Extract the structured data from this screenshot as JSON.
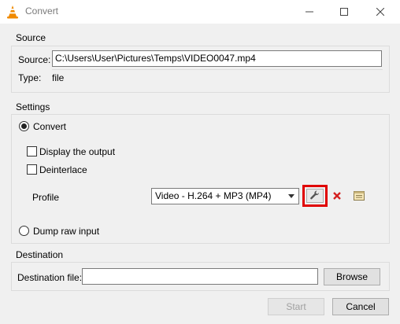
{
  "window": {
    "title": "Convert"
  },
  "source": {
    "group_title": "Source",
    "source_label": "Source:",
    "source_value": "C:\\Users\\User\\Pictures\\Temps\\VIDEO0047.mp4",
    "type_label": "Type:",
    "type_value": "file"
  },
  "settings": {
    "group_title": "Settings",
    "convert_label": "Convert",
    "display_output_label": "Display the output",
    "deinterlace_label": "Deinterlace",
    "profile_label": "Profile",
    "profile_selected": "Video - H.264 + MP3 (MP4)",
    "dump_raw_label": "Dump raw input",
    "icons": [
      "wrench-icon",
      "delete-x-icon",
      "new-profile-icon"
    ],
    "highlight_color": "#e00000"
  },
  "destination": {
    "group_title": "Destination",
    "file_label": "Destination file:",
    "file_value": "",
    "browse_label": "Browse"
  },
  "footer": {
    "start_label": "Start",
    "cancel_label": "Cancel"
  }
}
